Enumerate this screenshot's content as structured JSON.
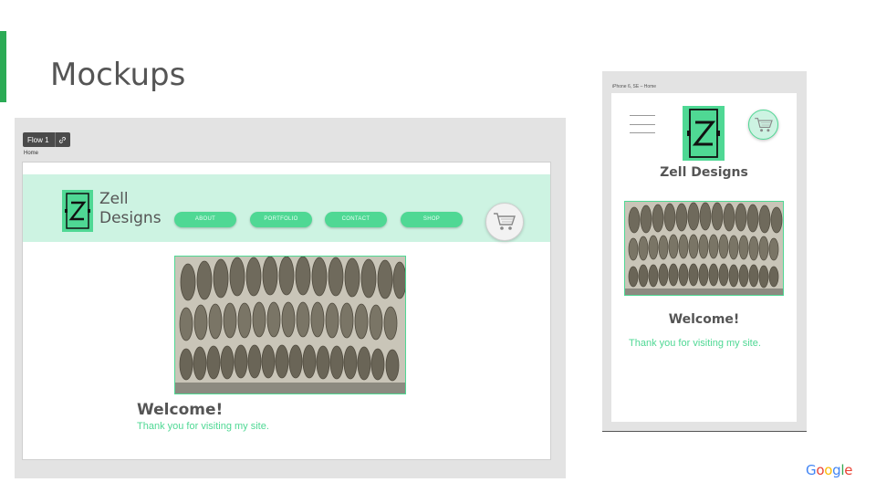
{
  "slide": {
    "title": "Mockups",
    "accent_color": "#2bab55",
    "logo_letters": [
      "G",
      "o",
      "o",
      "g",
      "l",
      "e"
    ],
    "logo_colors": [
      "#4285F4",
      "#EA4335",
      "#FBBC05",
      "#4285F4",
      "#34A853",
      "#EA4335"
    ]
  },
  "desktop": {
    "flow_label": "Flow 1",
    "flow_link_icon": "link-icon",
    "page_label": "Home",
    "brand_line1": "Zell",
    "brand_line2": "Designs",
    "nav": [
      "ABOUT",
      "PORTFOLIO",
      "CONTACT",
      "SHOP"
    ],
    "cart_icon": "cart-icon",
    "welcome": "Welcome!",
    "thanks": "Thank you for visiting my site."
  },
  "mobile": {
    "frame_label": "iPhone 6, SE – Home",
    "menu_icon": "hamburger-icon",
    "brand": "Zell Designs",
    "cart_icon": "cart-icon",
    "welcome": "Welcome!",
    "thanks": "Thank you for visiting my site."
  },
  "colors": {
    "mint": "#4fd894",
    "mint_light": "#cdf3e2",
    "text_gray": "#555555"
  }
}
